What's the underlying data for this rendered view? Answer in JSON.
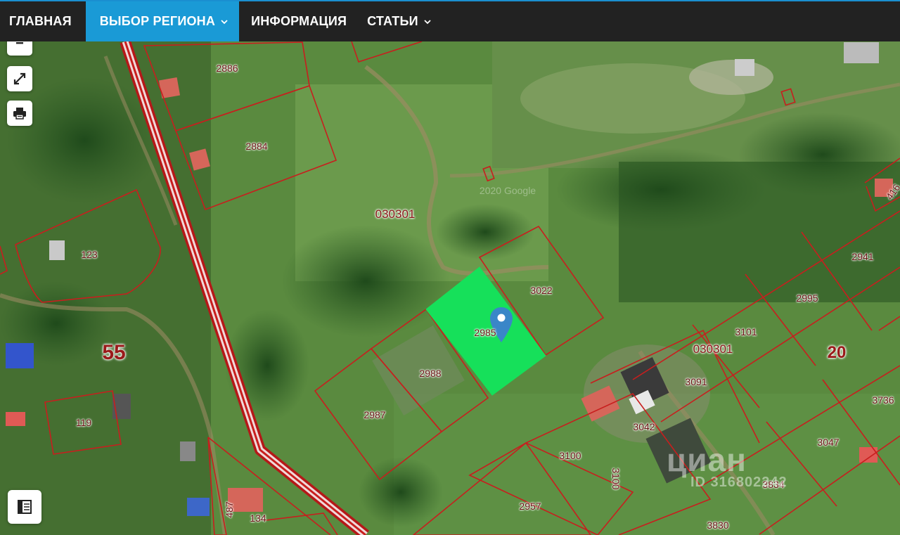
{
  "nav": {
    "items": [
      {
        "label": "ГЛАВНАЯ",
        "has_dropdown": false,
        "active": false
      },
      {
        "label": "ВЫБОР РЕГИОНА",
        "has_dropdown": true,
        "active": true
      },
      {
        "label": "ИНФОРМАЦИЯ",
        "has_dropdown": false,
        "active": false
      },
      {
        "label": "СТАТЬИ",
        "has_dropdown": true,
        "active": false
      }
    ]
  },
  "map": {
    "controls": {
      "zoom_out_icon": "minus-icon",
      "fullscreen_icon": "expand-icon",
      "print_icon": "printer-icon",
      "layers_icon": "map-layers-icon"
    },
    "quarter_labels": [
      "030301",
      "030301"
    ],
    "district_labels": [
      "55",
      "20"
    ],
    "attribution": "2020 Google",
    "marker_icon": "map-pin-icon",
    "selected_parcel_color": "#16e05a",
    "parcel_line_color": "#c81e1e",
    "road_color": "#c81e1e",
    "parcels": [
      "2886",
      "2884",
      "123",
      "3022",
      "2985",
      "2988",
      "2987",
      "119",
      "134",
      "487",
      "3100",
      "3100",
      "2957",
      "3042",
      "3091",
      "3101",
      "2995",
      "2941",
      "416",
      "3736",
      "3047",
      "3834",
      "3830"
    ],
    "watermark": {
      "brand": "циан",
      "id_text": "ID 316802242"
    }
  }
}
